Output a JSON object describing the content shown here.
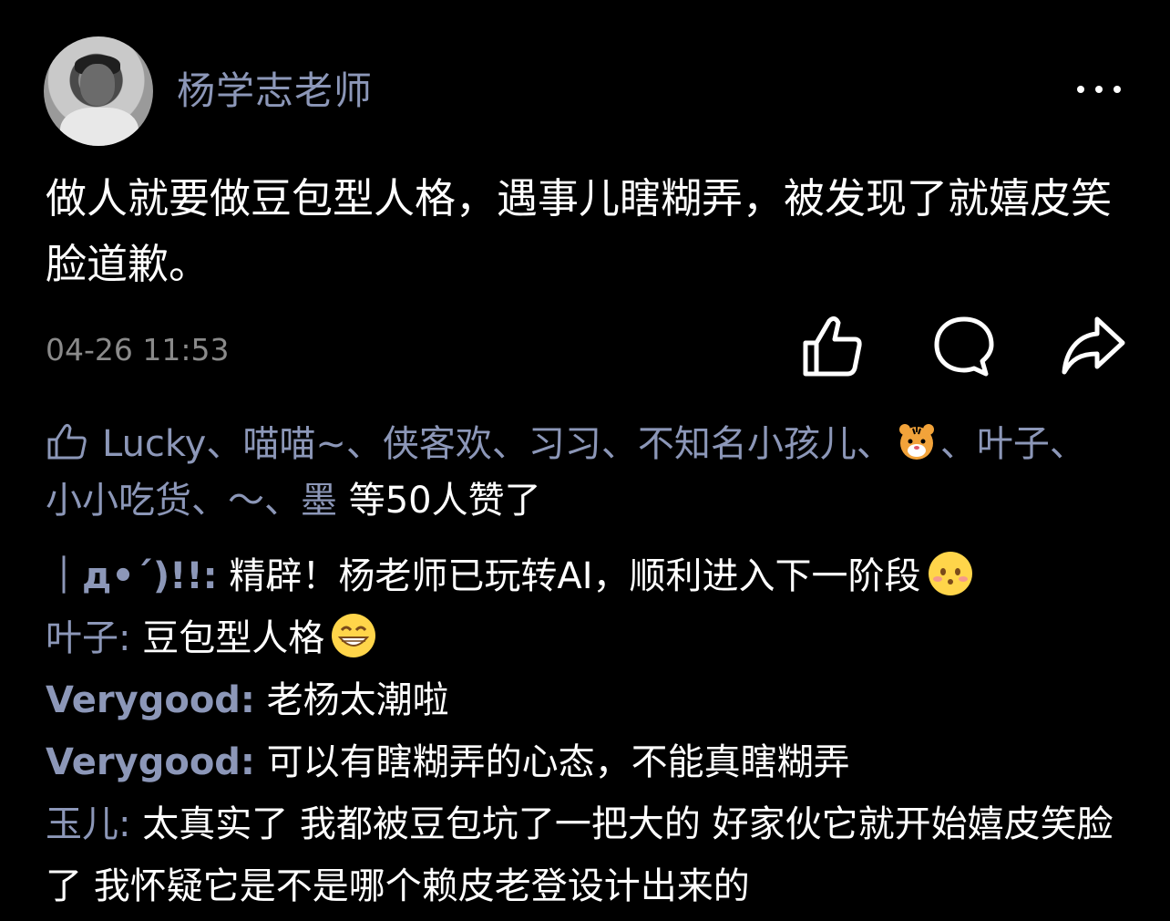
{
  "post": {
    "author": "杨学志老师",
    "content": "做人就要做豆包型人格，遇事儿瞎糊弄，被发现了就嬉皮笑脸道歉。",
    "time": "04-26 11:53"
  },
  "likes": {
    "names_part1": "Lucky、喵喵~、侠客欢、习习、不知名小孩儿、",
    "names_part2": "、叶子、小小吃货、～、墨",
    "count_text": " 等50人赞了"
  },
  "comments": [
    {
      "name": "｜д•´)!!:",
      "text": " 精辟！杨老师已玩转AI，顺利进入下一阶段"
    },
    {
      "name": "叶子:",
      "text": " 豆包型人格"
    },
    {
      "name": "Verygood:",
      "text": " 老杨太潮啦"
    },
    {
      "name": "Verygood:",
      "text": " 可以有瞎糊弄的心态，不能真瞎糊弄"
    },
    {
      "name": "玉儿:",
      "text": " 太真实了 我都被豆包坑了一把大的 好家伙它就开始嬉皮笑脸了 我怀疑它是不是哪个赖皮老登设计出来的"
    }
  ],
  "icons": {
    "like": "thumbs-up-icon",
    "comment": "comment-bubble-icon",
    "share": "share-arrow-icon",
    "more": "more-dots-icon"
  },
  "colors": {
    "background": "#000000",
    "name_color": "#8c97b8",
    "time_color": "#8a8a8a"
  }
}
